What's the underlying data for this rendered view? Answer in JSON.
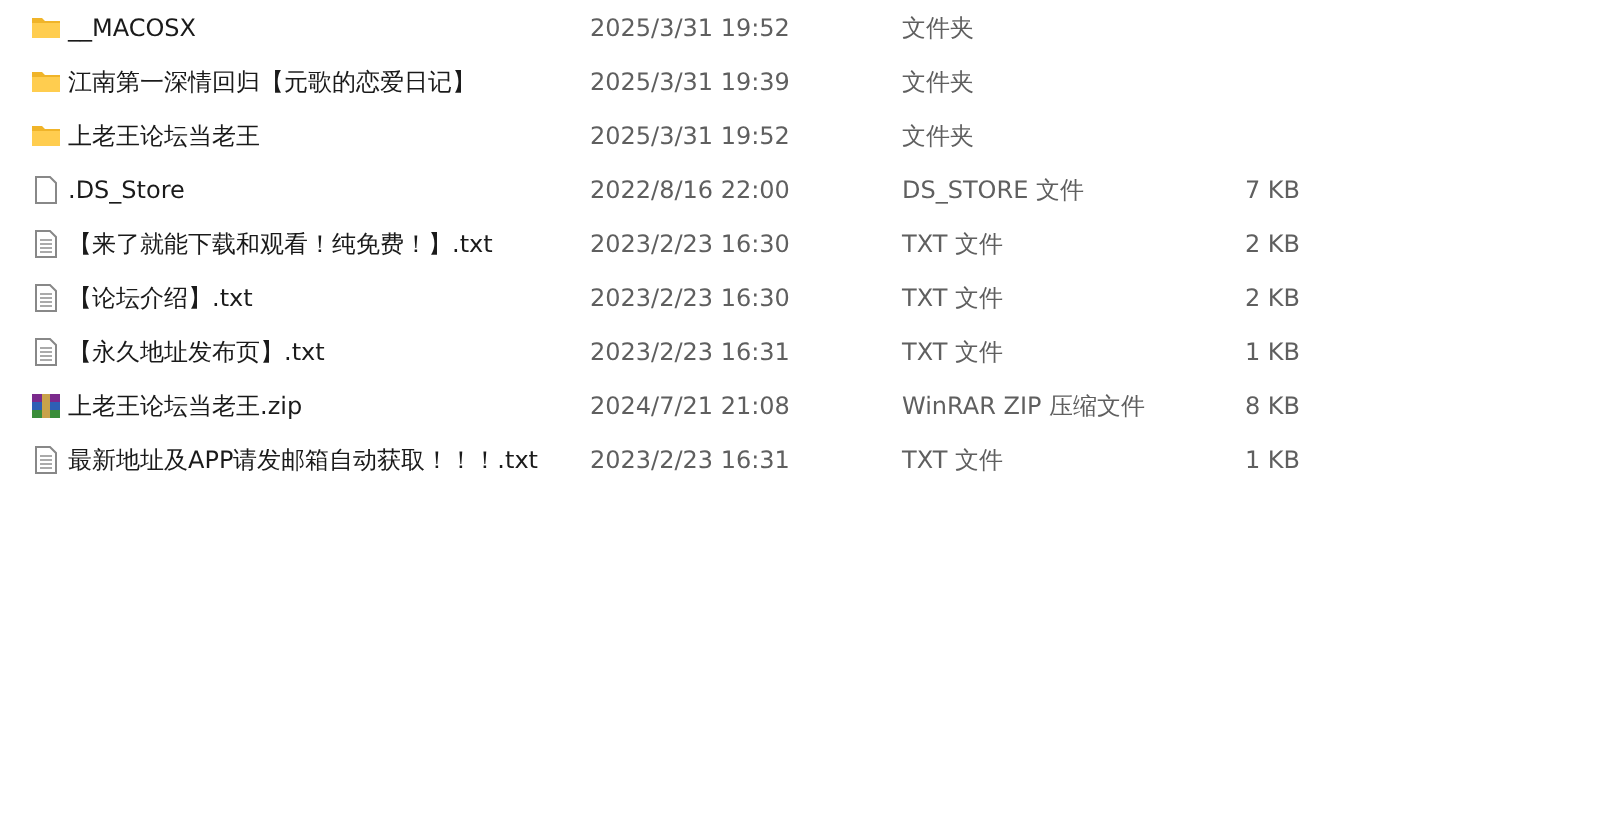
{
  "files": [
    {
      "kind": "folder",
      "name": "__MACOSX",
      "modified": "2025/3/31 19:52",
      "type": "文件夹"
    },
    {
      "kind": "folder",
      "name": "江南第一深情回归【元歌的恋爱日记】",
      "modified": "2025/3/31 19:39",
      "type": "文件夹"
    },
    {
      "kind": "folder",
      "name": "上老王论坛当老王",
      "modified": "2025/3/31 19:52",
      "type": "文件夹"
    },
    {
      "kind": "file",
      "name": ".DS_Store",
      "modified": "2022/8/16 22:00",
      "type": "DS_STORE 文件",
      "size": "7 KB"
    },
    {
      "kind": "text",
      "name": "【来了就能下载和观看！纯免费！】.txt",
      "modified": "2023/2/23 16:30",
      "type": "TXT 文件",
      "size": "2 KB"
    },
    {
      "kind": "text",
      "name": "【论坛介绍】.txt",
      "modified": "2023/2/23 16:30",
      "type": "TXT 文件",
      "size": "2 KB"
    },
    {
      "kind": "text",
      "name": "【永久地址发布页】.txt",
      "modified": "2023/2/23 16:31",
      "type": "TXT 文件",
      "size": "1 KB"
    },
    {
      "kind": "zip",
      "name": "上老王论坛当老王.zip",
      "modified": "2024/7/21 21:08",
      "type": "WinRAR ZIP 压缩文件",
      "size": "8 KB"
    },
    {
      "kind": "text",
      "name": "最新地址及APP请发邮箱自动获取！！！.txt",
      "modified": "2023/2/23 16:31",
      "type": "TXT 文件",
      "size": "1 KB"
    }
  ]
}
